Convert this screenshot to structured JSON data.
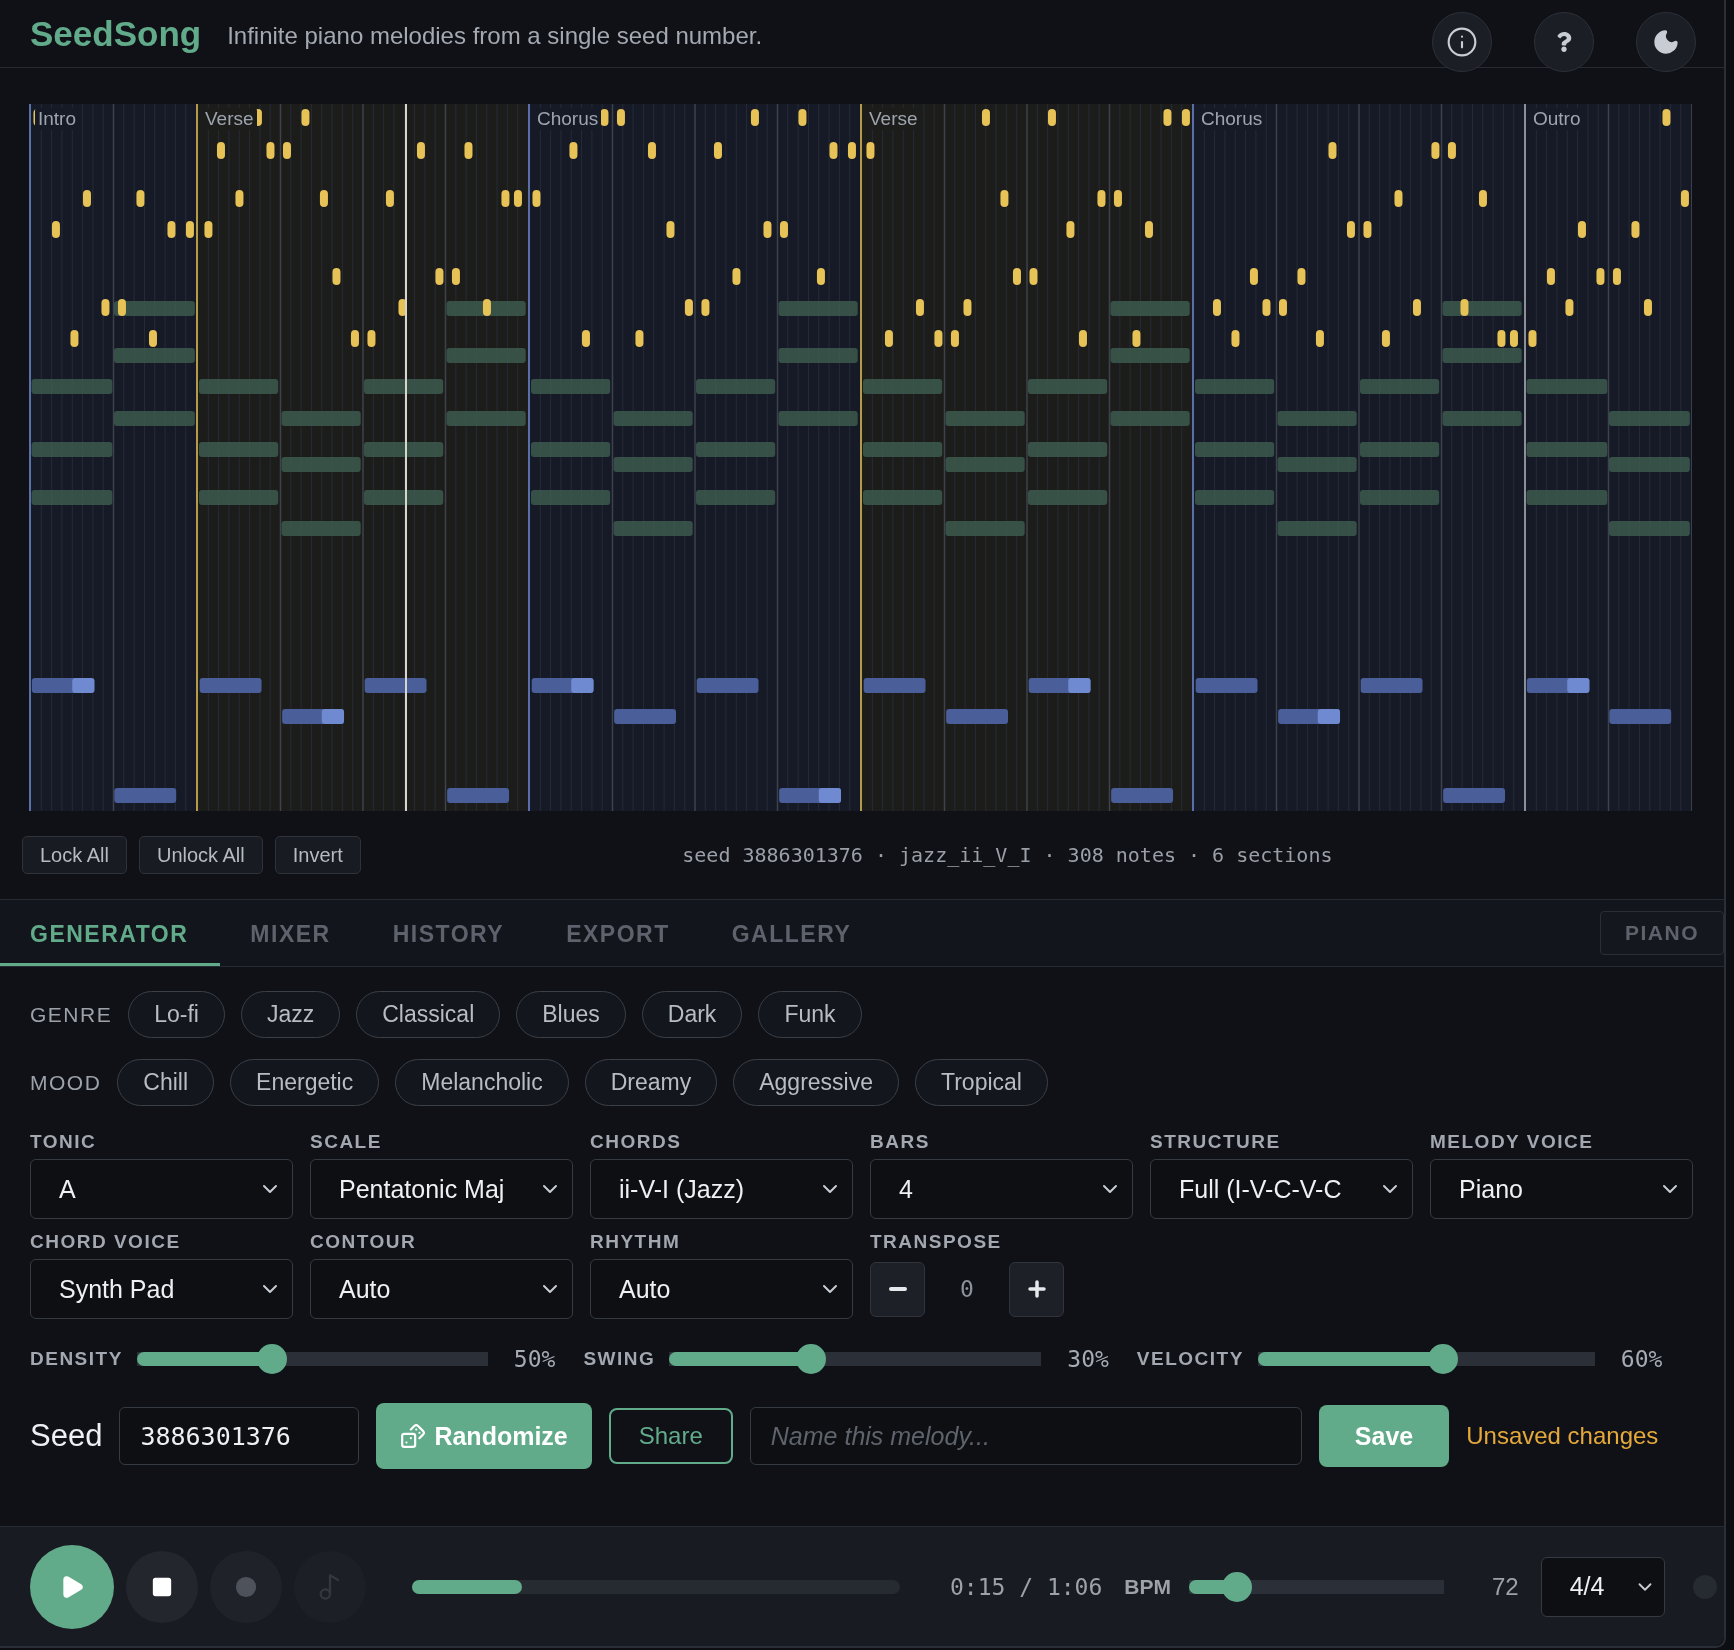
{
  "app": {
    "title": "SeedSong",
    "tagline": "Infinite piano melodies from a single seed number."
  },
  "piano_roll": {
    "sections": [
      {
        "label": "Intro",
        "kind": "intro"
      },
      {
        "label": "Verse",
        "kind": "verse"
      },
      {
        "label": "Chorus",
        "kind": "chorus"
      },
      {
        "label": "Verse",
        "kind": "verse"
      },
      {
        "label": "Chorus",
        "kind": "chorus"
      },
      {
        "label": "Outro",
        "kind": "outro"
      }
    ],
    "playhead": {
      "level": 0.226
    }
  },
  "roll_tools": {
    "buttons": [
      "Lock All",
      "Unlock All",
      "Invert"
    ],
    "summary": "seed 3886301376 · jazz_ii_V_I · 308 notes · 6 sections"
  },
  "tabs": [
    {
      "label": "GENERATOR",
      "selected": true
    },
    {
      "label": "MIXER",
      "selected": false
    },
    {
      "label": "HISTORY",
      "selected": false
    },
    {
      "label": "EXPORT",
      "selected": false
    },
    {
      "label": "GALLERY",
      "selected": false
    }
  ],
  "piano_toggle": {
    "label": "PIANO",
    "on": false
  },
  "genre": {
    "label": "GENRE",
    "options": [
      "Lo-fi",
      "Jazz",
      "Classical",
      "Blues",
      "Dark",
      "Funk"
    ]
  },
  "mood": {
    "label": "MOOD",
    "options": [
      "Chill",
      "Energetic",
      "Melancholic",
      "Dreamy",
      "Aggressive",
      "Tropical"
    ]
  },
  "fields": [
    {
      "label": "TONIC",
      "value": "A",
      "kind": "select"
    },
    {
      "label": "SCALE",
      "value": "Pentatonic Maj",
      "kind": "select"
    },
    {
      "label": "CHORDS",
      "value": "ii-V-I (Jazz)",
      "kind": "select"
    },
    {
      "label": "BARS",
      "value": "4",
      "kind": "select"
    },
    {
      "label": "STRUCTURE",
      "value": "Full (I-V-C-V-C",
      "kind": "select"
    },
    {
      "label": "MELODY VOICE",
      "value": "Piano",
      "kind": "select"
    },
    {
      "label": "CHORD VOICE",
      "value": "Synth Pad",
      "kind": "select"
    },
    {
      "label": "CONTOUR",
      "value": "Auto",
      "kind": "select"
    },
    {
      "label": "RHYTHM",
      "value": "Auto",
      "kind": "select"
    },
    {
      "label": "TRANSPOSE",
      "value": "0",
      "kind": "stepper"
    }
  ],
  "sliders": [
    {
      "label": "DENSITY",
      "level": 0.385,
      "reading": "50%"
    },
    {
      "label": "SWING",
      "level": 0.38,
      "reading": "30%"
    },
    {
      "label": "VELOCITY",
      "level": 0.55,
      "reading": "60%"
    }
  ],
  "seed": {
    "label": "Seed",
    "value": "3886301376",
    "randomize": "Randomize",
    "share": "Share",
    "name_placeholder": "Name this melody...",
    "save": "Save",
    "status": "Unsaved changes"
  },
  "transport": {
    "note_button": {
      "disabled": true
    },
    "progress": {
      "level": 0.225
    },
    "time": "0:15 / 1:06",
    "bpm_label": "BPM",
    "bpm": {
      "level": 0.19
    },
    "bpm_reading": "72",
    "meter": "4/4"
  }
}
